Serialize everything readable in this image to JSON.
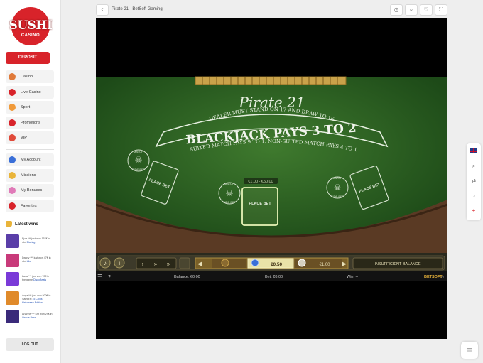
{
  "brand": {
    "logo_text": "SUSHI",
    "logo_sub": "CASINO",
    "accent": "#d8232a"
  },
  "sidebar": {
    "deposit_label": "DEPOSIT",
    "primary": [
      {
        "label": "Casino",
        "icon": "sushi-icon",
        "color": "#e07a3a"
      },
      {
        "label": "Live Casino",
        "icon": "dealer-icon",
        "color": "#d8232a"
      },
      {
        "label": "Sport",
        "icon": "ball-icon",
        "color": "#f09a3a"
      },
      {
        "label": "Promotions",
        "icon": "gift-icon",
        "color": "#d8232a"
      },
      {
        "label": "VIP",
        "icon": "vip-icon",
        "color": "#e04a3a"
      }
    ],
    "secondary": [
      {
        "label": "My Account",
        "icon": "user-icon",
        "color": "#3a6fd8"
      },
      {
        "label": "Missions",
        "icon": "trophy-icon",
        "color": "#e9b43a"
      },
      {
        "label": "My Bonuses",
        "icon": "bonus-icon",
        "color": "#e07ab8"
      },
      {
        "label": "Favorites",
        "icon": "heart-icon",
        "color": "#d8232a"
      }
    ],
    "latest_wins_title": "Latest wins",
    "latest_wins": [
      {
        "text": "Bjoe *** just won 157€ in slot",
        "game": "Blazing",
        "color": "#5a3ea8"
      },
      {
        "text": "Danny *** just won 47€ in slot",
        "game": "Lilo",
        "color": "#c83a7a"
      },
      {
        "text": "Lana *** just won 70€ in the game",
        "game": "DiscoBeats",
        "color": "#7a3ad8"
      },
      {
        "text": "Anya *** just won 500€ in Samurai",
        "game": "15 Coins Halloween Edition",
        "color": "#e08a2a"
      },
      {
        "text": "Arianne *** just won 29€ in",
        "game": "Oracle Brew",
        "color": "#3a2a7a"
      }
    ],
    "logout_label": "LOG OUT"
  },
  "topbar": {
    "title": "Pirate 21 · BetSoft Gaming",
    "icons": [
      "history-icon",
      "search-icon",
      "heart-icon",
      "fullscreen-icon"
    ]
  },
  "game": {
    "name": "Pirate 21",
    "rule_line": "DEALER MUST STAND ON 17 AND DRAW TO 16",
    "main_title": "BLACKJACK PAYS 3 TO 2",
    "suited_line": "SUITED MATCH PAYS 9 TO 1, NON-SUITED MATCH PAYS 4 TO 1",
    "match_label": "MATCH",
    "side_bet_label": "SIDE BET",
    "place_bet": "PLACE BET",
    "bet_range": "€1.00 - €50.00",
    "chips": [
      "€0.50",
      "€1.00"
    ],
    "insufficient": "INSUFFICIENT BALANCE",
    "balance_label": "Balance: €0.00",
    "bet_label": "Bet: €0.00",
    "win_label": "Win: --",
    "provider": "BETSOFT",
    "help": "?"
  },
  "rightbar": {
    "icons": [
      "uk-flag-icon",
      "search-icon",
      "shuffle-icon",
      "bell-icon",
      "plus-icon"
    ]
  },
  "chat_icon": "chat-icon"
}
